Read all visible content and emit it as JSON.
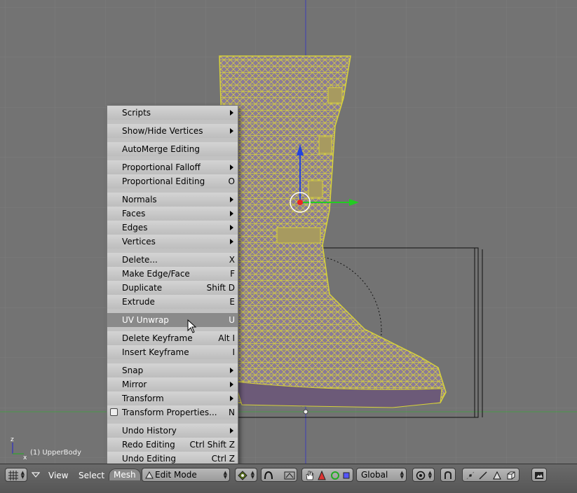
{
  "status": {
    "object_label": "(1) UpperBody",
    "axis_z": "z",
    "axis_x": "x"
  },
  "menu": {
    "title": "Mesh",
    "items": [
      {
        "label": "Scripts",
        "shortcut": "",
        "submenu": true
      },
      {
        "label": "Show/Hide Vertices",
        "shortcut": "",
        "submenu": true
      },
      {
        "label": "AutoMerge Editing",
        "shortcut": "",
        "submenu": false
      },
      {
        "label": "Proportional Falloff",
        "shortcut": "",
        "submenu": true
      },
      {
        "label": "Proportional Editing",
        "shortcut": "O",
        "submenu": false
      },
      {
        "label": "Normals",
        "shortcut": "",
        "submenu": true
      },
      {
        "label": "Faces",
        "shortcut": "",
        "submenu": true
      },
      {
        "label": "Edges",
        "shortcut": "",
        "submenu": true
      },
      {
        "label": "Vertices",
        "shortcut": "",
        "submenu": true
      },
      {
        "label": "Delete...",
        "shortcut": "X",
        "submenu": false
      },
      {
        "label": "Make Edge/Face",
        "shortcut": "F",
        "submenu": false
      },
      {
        "label": "Duplicate",
        "shortcut": "Shift D",
        "submenu": false
      },
      {
        "label": "Extrude",
        "shortcut": "E",
        "submenu": false
      },
      {
        "label": "UV Unwrap",
        "shortcut": "U",
        "submenu": false,
        "highlighted": true
      },
      {
        "label": "Delete Keyframe",
        "shortcut": "Alt I",
        "submenu": false
      },
      {
        "label": "Insert Keyframe",
        "shortcut": "I",
        "submenu": false
      },
      {
        "label": "Snap",
        "shortcut": "",
        "submenu": true
      },
      {
        "label": "Mirror",
        "shortcut": "",
        "submenu": true
      },
      {
        "label": "Transform",
        "shortcut": "",
        "submenu": true
      },
      {
        "label": "Transform Properties...",
        "shortcut": "N",
        "submenu": false,
        "checkbox": true
      },
      {
        "label": "Undo History",
        "shortcut": "",
        "submenu": true
      },
      {
        "label": "Redo Editing",
        "shortcut": "Ctrl Shift Z",
        "submenu": false
      },
      {
        "label": "Undo Editing",
        "shortcut": "Ctrl Z",
        "submenu": false
      }
    ]
  },
  "header": {
    "view_label": "View",
    "select_label": "Select",
    "mesh_label": "Mesh",
    "mode_value": "Edit Mode",
    "orientation_value": "Global"
  },
  "colors": {
    "wire": "#d8d23a",
    "mesh_fill": "#8a7a9a",
    "grid": "#7d7d7d",
    "viewport": "#737373"
  }
}
